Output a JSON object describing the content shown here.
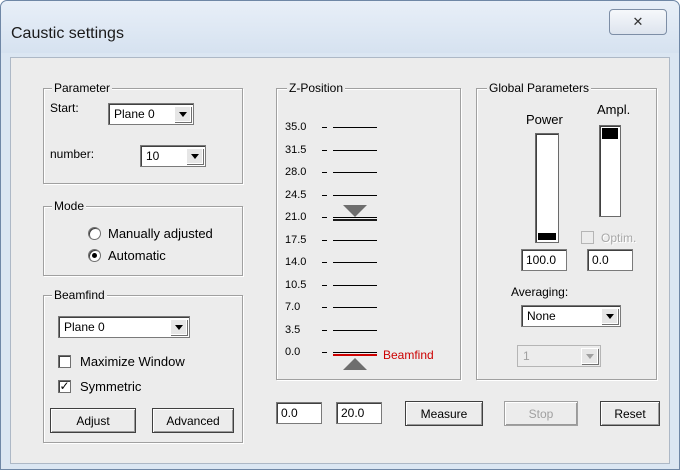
{
  "window": {
    "title": "Caustic settings",
    "close_glyph": "✕"
  },
  "parameter": {
    "legend": "Parameter",
    "start_label": "Start:",
    "start_value": "Plane 0",
    "number_label": "number:",
    "number_value": "10"
  },
  "mode": {
    "legend": "Mode",
    "options": [
      {
        "label": "Manually adjusted",
        "selected": false
      },
      {
        "label": "Automatic",
        "selected": true
      }
    ]
  },
  "beamfind": {
    "legend": "Beamfind",
    "plane_value": "Plane 0",
    "maximize_label": "Maximize Window",
    "maximize_checked": false,
    "symmetric_label": "Symmetric",
    "symmetric_checked": true,
    "adjust_label": "Adjust",
    "advanced_label": "Advanced"
  },
  "zposition": {
    "legend": "Z-Position",
    "ticks": [
      "35.0",
      "31.5",
      "28.0",
      "24.5",
      "21.0",
      "17.5",
      "14.0",
      "10.5",
      "7.0",
      "3.5",
      "0.0"
    ],
    "upper_marker_value": 20.0,
    "lower_marker_value": 0.0,
    "beamfind_label": "Beamfind",
    "beamfind_color": "#cc0000"
  },
  "global": {
    "legend": "Global Parameters",
    "power_label": "Power",
    "ampl_label": "Ampl.",
    "power_level": 0.07,
    "ampl_level": 0.13,
    "power_value": "100.0",
    "ampl_value": "0.0",
    "optim_label": "Optim.",
    "optim_checked": false,
    "averaging_label": "Averaging:",
    "averaging_value": "None",
    "count_value": "1"
  },
  "bottom": {
    "zmin_value": "0.0",
    "zmax_value": "20.0",
    "measure_label": "Measure",
    "stop_label": "Stop",
    "reset_label": "Reset"
  }
}
